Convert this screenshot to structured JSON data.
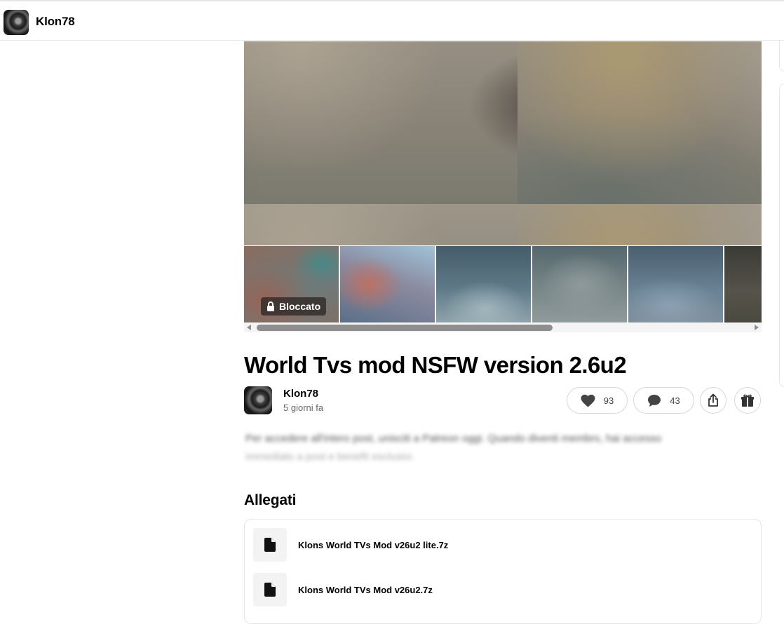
{
  "creator": {
    "name": "Klon78"
  },
  "gallery": {
    "locked_label": "Bloccato"
  },
  "post": {
    "title": "World Tvs mod NSFW version 2.6u2",
    "author": "Klon78",
    "time": "5 giorni fa",
    "likes": "93",
    "comments": "43",
    "locked_teaser": [
      "Per accedere all'intero post, unisciti a Patreon oggi. Quando diventi membro, hai accesso",
      "immediato a post e benefit esclusivi."
    ]
  },
  "attachments": {
    "title": "Allegati",
    "files": [
      {
        "name": "Klons World TVs Mod v26u2 lite.7z"
      },
      {
        "name": "Klons World TVs Mod v26u2.7z"
      }
    ]
  },
  "icons": {
    "lock": "lock-icon",
    "heart": "heart-icon",
    "comment": "comment-icon",
    "share": "share-icon",
    "gift": "gift-icon",
    "file": "file-icon"
  }
}
